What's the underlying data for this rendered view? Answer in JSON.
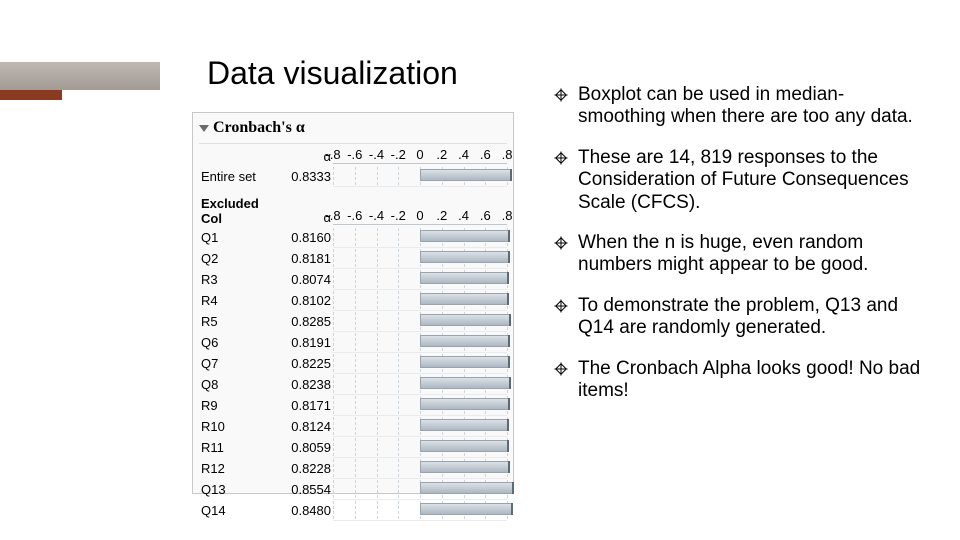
{
  "slide": {
    "title": "Data visualization"
  },
  "panel": {
    "title": "Cronbach's α",
    "alpha_header": "α",
    "axis": {
      "min": -0.8,
      "max": 0.8,
      "ticks": [
        "-.8",
        "-.6",
        "-.4",
        "-.2",
        "0",
        ".2",
        ".4",
        ".6",
        ".8"
      ],
      "tick_values": [
        -0.8,
        -0.6,
        -0.4,
        -0.2,
        0,
        0.2,
        0.4,
        0.6,
        0.8
      ]
    },
    "entire": {
      "label": "Entire set",
      "alpha": "0.8333"
    },
    "excluded_header": {
      "line1": "Excluded",
      "line2": "Col"
    },
    "rows": [
      {
        "label": "Q1",
        "alpha": "0.8160"
      },
      {
        "label": "Q2",
        "alpha": "0.8181"
      },
      {
        "label": "R3",
        "alpha": "0.8074"
      },
      {
        "label": "R4",
        "alpha": "0.8102"
      },
      {
        "label": "R5",
        "alpha": "0.8285"
      },
      {
        "label": "Q6",
        "alpha": "0.8191"
      },
      {
        "label": "Q7",
        "alpha": "0.8225"
      },
      {
        "label": "Q8",
        "alpha": "0.8238"
      },
      {
        "label": "R9",
        "alpha": "0.8171"
      },
      {
        "label": "R10",
        "alpha": "0.8124"
      },
      {
        "label": "R11",
        "alpha": "0.8059"
      },
      {
        "label": "R12",
        "alpha": "0.8228"
      },
      {
        "label": "Q13",
        "alpha": "0.8554"
      },
      {
        "label": "Q14",
        "alpha": "0.8480"
      }
    ]
  },
  "bullets": [
    "Boxplot can be used in median-smoothing when there are too any data.",
    "These are 14, 819 responses to the Consideration of Future Consequences Scale (CFCS).",
    "When the n is huge, even random numbers might appear to be good.",
    "To demonstrate the problem, Q13 and Q14 are randomly generated.",
    "The Cronbach Alpha looks good! No bad items!"
  ],
  "chart_data": {
    "type": "bar",
    "title": "Cronbach's α",
    "xlabel": "α",
    "xlim": [
      -0.8,
      0.8
    ],
    "categories": [
      "Entire set",
      "Q1",
      "Q2",
      "R3",
      "R4",
      "R5",
      "Q6",
      "Q7",
      "Q8",
      "R9",
      "R10",
      "R11",
      "R12",
      "Q13",
      "Q14"
    ],
    "values": [
      0.8333,
      0.816,
      0.8181,
      0.8074,
      0.8102,
      0.8285,
      0.8191,
      0.8225,
      0.8238,
      0.8171,
      0.8124,
      0.8059,
      0.8228,
      0.8554,
      0.848
    ]
  }
}
